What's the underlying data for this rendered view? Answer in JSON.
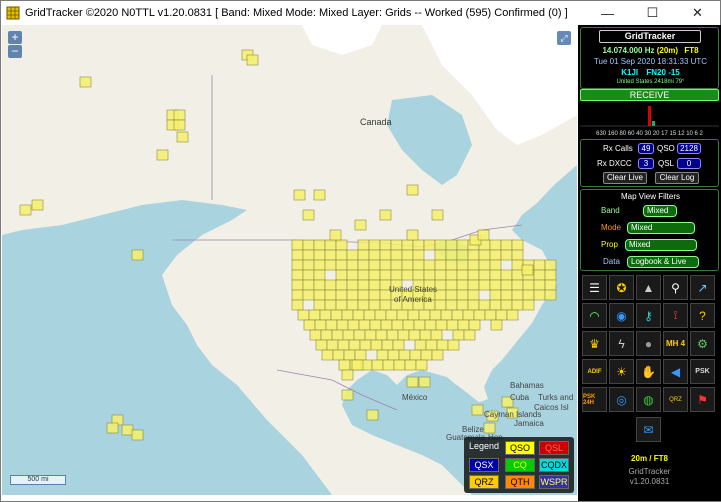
{
  "window": {
    "title": "GridTracker ©2020 N0TTL v1.20.0831 [ Band: Mixed Mode: Mixed Layer: Grids -- Worked (595) Confirmed (0) ]",
    "minimize": "—",
    "maximize": "☐",
    "close": "✕"
  },
  "map": {
    "zoom_in": "+",
    "zoom_out": "−",
    "scale": "500 mi",
    "labels": {
      "canada": "Canada",
      "usa_1": "United States",
      "usa_2": "of America",
      "mexico": "México",
      "bahamas": "Bahamas",
      "cuba": "Cuba",
      "turks": "Turks and",
      "caicos": "Caicos Isl",
      "cayman": "Cayman Islands",
      "jamaica": "Jamaica",
      "belize": "Belize",
      "guatemala": "Guatemala",
      "honduras": "Hon"
    }
  },
  "legend": {
    "title": "Legend",
    "items": [
      {
        "label": "QSO",
        "bg": "#ffff00",
        "fg": "#000"
      },
      {
        "label": "QSL",
        "bg": "#cc0000",
        "fg": "#ff6666"
      },
      {
        "label": "QSX",
        "bg": "#0000aa",
        "fg": "#fff"
      },
      {
        "label": "CQ",
        "bg": "#00cc00",
        "fg": "#ffff00"
      },
      {
        "label": "CQDX",
        "bg": "#00dddd",
        "fg": "#000"
      },
      {
        "label": "QRZ",
        "bg": "#ffcc00",
        "fg": "#000"
      },
      {
        "label": "QTH",
        "bg": "#ff8800",
        "fg": "#000"
      },
      {
        "label": "WSPR",
        "bg": "#333399",
        "fg": "#ffff66"
      }
    ]
  },
  "panel": {
    "app_name": "GridTracker",
    "frequency": "14.074.000 Hz",
    "band": "(20m)",
    "mode": "FT8",
    "datetime": "Tue 01 Sep 2020 18:31:33 UTC",
    "callsign": "K1JI",
    "grid": "FN20",
    "offset": "-15",
    "distance": "United States 2418mi 79°",
    "receive": "RECEIVE",
    "meter_scale": "630 160 80 60 40 30 20 17 15 12 10 6  2",
    "rx_calls_label": "Rx Calls",
    "rx_calls": "49",
    "qso_label": "QSO",
    "qso": "2128",
    "rx_dxcc_label": "Rx DXCC",
    "rx_dxcc": "3",
    "qsl_label": "QSL",
    "qsl": "0",
    "clear_live": "Clear Live",
    "clear_log": "Clear Log",
    "filters_title": "Map View Filters",
    "band_label": "Band",
    "band_value": "Mixed",
    "mode_label": "Mode",
    "mode_value": "Mixed",
    "prop_label": "Prop",
    "prop_value": "Mixed",
    "data_label": "Data",
    "data_value": "Logbook & Live",
    "footer_band": "20m / FT8",
    "footer_app": "GridTracker",
    "footer_version": "v1.20.0831"
  },
  "icons": [
    "checklist-icon",
    "medal-icon",
    "map-layers-icon",
    "search-icon",
    "chart-icon",
    "wifi-icon",
    "globe-icon",
    "key-icon",
    "antenna-icon",
    "help-icon",
    "trophy-icon",
    "lightning-icon",
    "moon-icon",
    "maidenhead-icon",
    "settings-icon",
    "adif-icon",
    "sun-icon",
    "hand-icon",
    "speaker-icon",
    "psk-spots-icon",
    "psk-24-icon",
    "globe-time-icon",
    "radar-icon",
    "qrz-icon",
    "flag-icon",
    "chat-icon"
  ],
  "icon_text": {
    "adif": "ADIF",
    "psk": "PSK",
    "psk24": "PSK 24H",
    "mh": "MH 4",
    "qrz": "QRZ"
  }
}
